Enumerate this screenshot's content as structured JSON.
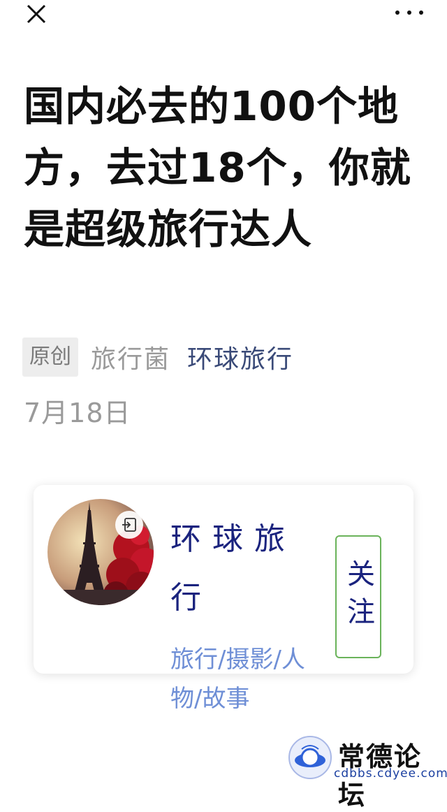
{
  "topbar": {
    "close_icon": "close-icon",
    "more_icon": "more-icon"
  },
  "article": {
    "title": "国内必去的100个地方，去过18个，你就是超级旅行达人",
    "badge": "原创",
    "author": "旅行菌",
    "account": "环球旅行",
    "date": "7月18日"
  },
  "profile_card": {
    "name": "环球旅行",
    "description": "旅行/摄影/人物/故事",
    "follow_label": "关注",
    "avatar_icon": "eiffel-tower-avatar",
    "badge_icon": "login-icon"
  },
  "watermark": {
    "logo": "常",
    "text": "常德论坛",
    "url": "cdbbs.cdyee.com"
  }
}
